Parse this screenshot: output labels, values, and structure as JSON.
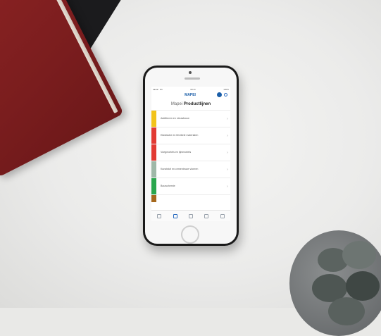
{
  "status": {
    "left": "●●●●○ 3G",
    "time": "09:41",
    "right": "100%"
  },
  "app": {
    "logo": "MAPEI"
  },
  "page_title": {
    "prefix": "Mapei ",
    "bold": "Productlijnen"
  },
  "categories": [
    {
      "label": "Additieven en nieuwbouw",
      "color": "#f2c31b"
    },
    {
      "label": "Elastische en flexibele materialen",
      "color": "#e23a33"
    },
    {
      "label": "Voegmortels en lijmmortels",
      "color": "#e23a33"
    },
    {
      "label": "Kunststof en cementeuze vloeren",
      "color": "#9fb8a8"
    },
    {
      "label": "Bouwchemie",
      "color": "#2aa64d"
    }
  ],
  "tabs": [
    "home",
    "products",
    "catalog",
    "docs",
    "more"
  ]
}
